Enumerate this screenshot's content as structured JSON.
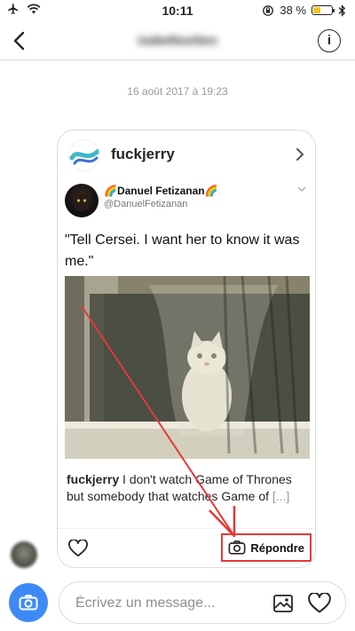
{
  "status_bar": {
    "time": "10:11",
    "battery": "38 %",
    "battery_level": 0.38
  },
  "header": {
    "title": "isabelleurbes"
  },
  "conversation": {
    "timestamp": "16 août 2017 à 19:23"
  },
  "shared_post": {
    "account": "fuckjerry",
    "tweet": {
      "name": "Danuel Fetizanan",
      "handle": "@DanuelFetizanan",
      "text": "\"Tell Cersei. I want her to know it was me.\""
    },
    "caption_user": "fuckjerry",
    "caption_text": " I don't watch Game of Thrones but somebody that watches Game of ",
    "caption_more": "[...]",
    "reply_label": "Répondre"
  },
  "composer": {
    "placeholder": "Écrivez un message..."
  },
  "colors": {
    "accent_blue": "#3d8af7",
    "annotation_red": "#e53935"
  }
}
